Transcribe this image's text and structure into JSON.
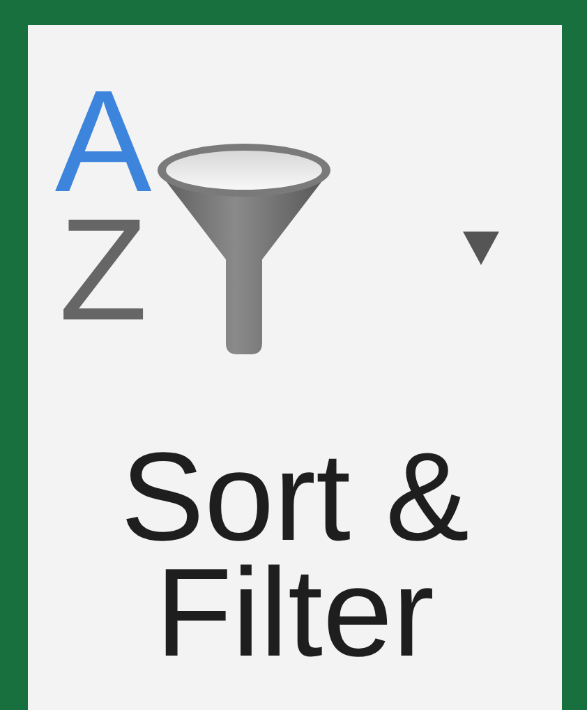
{
  "button": {
    "label_lines": [
      "Sort &",
      "Filter"
    ],
    "icon_letters": [
      "A",
      "Z"
    ]
  }
}
